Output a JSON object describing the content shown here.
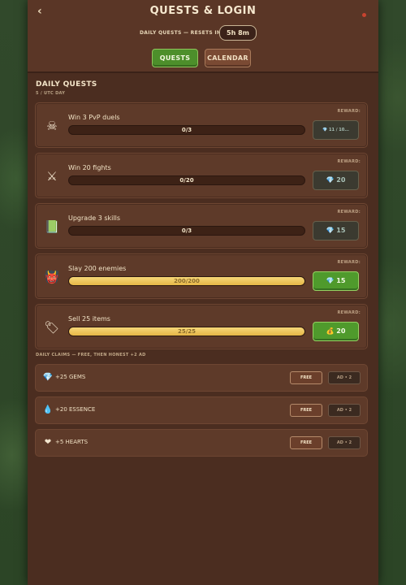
{
  "header": {
    "back_glyph": "‹",
    "title": "QUESTS & LOGIN",
    "reset_label": "DAILY QUESTS — RESETS IN",
    "reset_time": "5h 8m"
  },
  "tabs": [
    {
      "label": "QUESTS",
      "active": true
    },
    {
      "label": "CALENDAR",
      "active": false
    }
  ],
  "daily": {
    "title": "DAILY QUESTS",
    "subtitle": "5 / UTC DAY",
    "reward_label": "REWARD:",
    "quests": [
      {
        "icon": "skull-icon",
        "glyph": "☠",
        "name": "Win 3 PvP duels",
        "progress_text": "0/3",
        "progress": 0.0,
        "reward": "💎 11 / 10...",
        "reward_state": "locked"
      },
      {
        "icon": "crossed-swords-icon",
        "glyph": "⚔",
        "name": "Win 20 fights",
        "progress_text": "0/20",
        "progress": 0.0,
        "reward": "💎 20",
        "reward_state": "locked"
      },
      {
        "icon": "book-icon",
        "glyph": "📗",
        "name": "Upgrade 3 skills",
        "progress_text": "0/3",
        "progress": 0.0,
        "reward": "💎 15",
        "reward_state": "locked"
      },
      {
        "icon": "demon-head-icon",
        "glyph": "👹",
        "name": "Slay 200 enemies",
        "progress_text": "200/200",
        "progress": 1.0,
        "reward": "💎 15",
        "reward_state": "ready"
      },
      {
        "icon": "price-tag-icon",
        "glyph": "🏷",
        "name": "Sell 25 items",
        "progress_text": "25/25",
        "progress": 1.0,
        "reward": "💰 20",
        "reward_state": "ready"
      }
    ]
  },
  "claims": {
    "title": "DAILY CLAIMS — FREE, THEN HONEST +2 AD",
    "items": [
      {
        "icon": "gem-icon",
        "glyph": "💎",
        "name": "+25 GEMS",
        "free_label": "FREE",
        "ad_label": "AD • 2"
      },
      {
        "icon": "essence-drop-icon",
        "glyph": "💧",
        "name": "+20 ESSENCE",
        "free_label": "FREE",
        "ad_label": "AD • 2"
      },
      {
        "icon": "heart-icon",
        "glyph": "❤",
        "name": "+5 HEARTS",
        "free_label": "FREE",
        "ad_label": "AD • 2"
      }
    ]
  },
  "colors": {
    "panel": "#4b2d20",
    "progress_fill": "#e5b647",
    "ready_green": "#4f9a2c"
  }
}
